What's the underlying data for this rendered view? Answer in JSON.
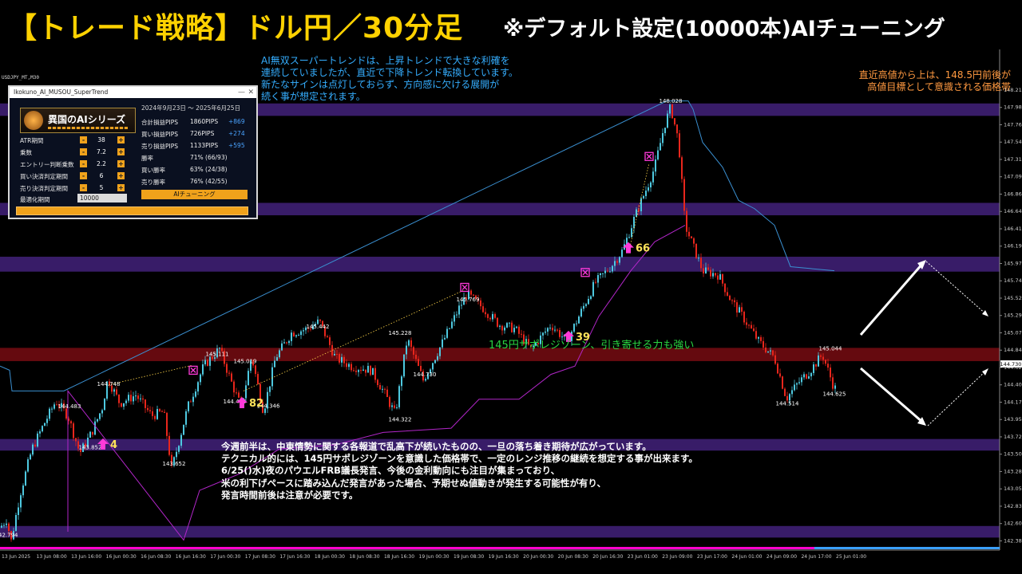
{
  "title": {
    "main": "【トレード戦略】ドル円／30分足",
    "sub": "※デフォルト設定(10000本)AIチューニング"
  },
  "symbol_label": "USDJPY_MT,M30",
  "notes": {
    "ai_trend": [
      "AI無双スーパートレンドは、上昇トレンドで大きな利確を",
      "連続していましたが、直近で下降トレンド転換しています。",
      "新たなサインは点灯しておらず、方向感に欠ける展開が",
      "続く事が想定されます。"
    ],
    "target": [
      "直近高値から上は、148.5円前後が",
      "高値目標として意識される価格帯"
    ],
    "zone": "145円サポレジゾーン、引き寄せる力も強い",
    "outlook": [
      "今週前半は、中東情勢に関する各報道で乱高下が続いたものの、一旦の落ち着き期待が広がっています。",
      "テクニカル的には、145円サポレジゾーンを意識した価格帯で、一定のレンジ推移の継続を想定する事が出来ます。",
      "6/25()水)夜のパウエルFRB議長発言、今後の金利動向にも注目が集まっており、",
      "米の利下げペースに踏み込んだ発言があった場合、予期せぬ値動きが発生する可能性が有り、",
      "発言時間前後は注意が必要です。"
    ]
  },
  "panel": {
    "window_title": "Ikokuno_AI_MUSOU_SuperTrend",
    "banner": "異国のAIシリーズ",
    "period": "2024年9月23日 ～ 2025年6月25日",
    "params": [
      {
        "label": "ATR期間",
        "value": "38"
      },
      {
        "label": "乗数",
        "value": "7.2"
      },
      {
        "label": "エントリー判断乗数",
        "value": "2.2"
      },
      {
        "label": "買い決済判定期間",
        "value": "6"
      },
      {
        "label": "売り決済判定期間",
        "value": "5"
      }
    ],
    "minus": "-",
    "plus": "+",
    "stats": [
      {
        "label": "合計損益PIPS",
        "value": "1860PIPS",
        "diff": "+869"
      },
      {
        "label": "買い損益PIPS",
        "value": "726PIPS",
        "diff": "+274"
      },
      {
        "label": "売り損益PIPS",
        "value": "1133PIPS",
        "diff": "+595"
      },
      {
        "label": "勝率",
        "value": "71% (66/93)",
        "diff": ""
      },
      {
        "label": "買い勝率",
        "value": "63% (24/38)",
        "diff": ""
      },
      {
        "label": "売り勝率",
        "value": "76% (42/55)",
        "diff": ""
      }
    ],
    "tune_button": "AIチューニング",
    "opt_label": "最適化期間",
    "opt_value": "10000"
  },
  "chart_data": {
    "type": "candlestick",
    "symbol": "USDJPY",
    "timeframe": "M30",
    "ylim": [
      142.66,
      148.26
    ],
    "price_ticks": [
      "148.210",
      "147.985",
      "147.760",
      "147.540",
      "147.315",
      "147.090",
      "146.865",
      "146.640",
      "146.415",
      "146.190",
      "145.970",
      "145.745",
      "145.520",
      "145.295",
      "145.070",
      "144.845",
      "144.625",
      "144.400",
      "144.175",
      "143.950",
      "143.725",
      "143.500",
      "143.280",
      "143.055",
      "142.830",
      "142.605",
      "142.380"
    ],
    "time_ticks": [
      "13 Jun 2025",
      "13 Jun 08:00",
      "13 Jun 16:00",
      "16 Jun 00:30",
      "16 Jun 08:30",
      "16 Jun 16:30",
      "17 Jun 00:30",
      "17 Jun 08:30",
      "17 Jun 16:30",
      "18 Jun 00:30",
      "18 Jun 08:30",
      "18 Jun 16:30",
      "19 Jun 00:30",
      "19 Jun 08:30",
      "19 Jun 16:30",
      "20 Jun 00:30",
      "20 Jun 08:30",
      "20 Jun 16:30",
      "23 Jun 01:00",
      "23 Jun 09:00",
      "23 Jun 17:00",
      "24 Jun 01:00",
      "24 Jun 09:00",
      "24 Jun 17:00",
      "25 Jun 01:00"
    ],
    "current_price": "144.730",
    "price_path": [
      [
        0,
        142.95
      ],
      [
        8,
        143.05
      ],
      [
        14,
        142.79
      ],
      [
        25,
        143.35
      ],
      [
        40,
        143.9
      ],
      [
        55,
        144.2
      ],
      [
        70,
        144.48
      ],
      [
        85,
        144.3
      ],
      [
        100,
        143.85
      ],
      [
        115,
        144.1
      ],
      [
        128,
        144.4
      ],
      [
        135,
        144.75
      ],
      [
        150,
        144.45
      ],
      [
        170,
        144.55
      ],
      [
        190,
        144.3
      ],
      [
        205,
        144.35
      ],
      [
        215,
        143.65
      ],
      [
        235,
        144.4
      ],
      [
        255,
        144.9
      ],
      [
        275,
        145.11
      ],
      [
        290,
        144.7
      ],
      [
        302,
        144.4
      ],
      [
        315,
        145.02
      ],
      [
        330,
        144.35
      ],
      [
        345,
        145.0
      ],
      [
        365,
        145.3
      ],
      [
        385,
        145.35
      ],
      [
        400,
        145.44
      ],
      [
        420,
        145.0
      ],
      [
        440,
        144.9
      ],
      [
        465,
        144.85
      ],
      [
        480,
        144.6
      ],
      [
        495,
        144.32
      ],
      [
        510,
        145.23
      ],
      [
        530,
        144.73
      ],
      [
        555,
        145.2
      ],
      [
        575,
        145.6
      ],
      [
        585,
        145.77
      ],
      [
        605,
        145.6
      ],
      [
        625,
        145.4
      ],
      [
        645,
        145.35
      ],
      [
        665,
        145.1
      ],
      [
        690,
        145.4
      ],
      [
        710,
        145.2
      ],
      [
        725,
        145.5
      ],
      [
        745,
        145.9
      ],
      [
        765,
        146.1
      ],
      [
        780,
        146.3
      ],
      [
        795,
        146.7
      ],
      [
        810,
        147.05
      ],
      [
        820,
        147.3
      ],
      [
        832,
        147.8
      ],
      [
        840,
        148.03
      ],
      [
        850,
        147.6
      ],
      [
        858,
        146.6
      ],
      [
        870,
        146.3
      ],
      [
        880,
        146.05
      ],
      [
        900,
        146.0
      ],
      [
        915,
        145.7
      ],
      [
        930,
        145.5
      ],
      [
        950,
        145.2
      ],
      [
        970,
        145.0
      ],
      [
        985,
        144.51
      ],
      [
        1000,
        144.7
      ],
      [
        1015,
        144.85
      ],
      [
        1030,
        145.04
      ],
      [
        1045,
        144.63
      ]
    ],
    "supertrend_upper": [
      [
        0,
        144.9
      ],
      [
        12,
        144.85
      ],
      [
        15,
        144.6
      ],
      [
        60,
        144.6
      ],
      [
        80,
        144.6
      ],
      [
        835,
        148.1
      ],
      [
        862,
        148.1
      ],
      [
        868,
        148.0
      ],
      [
        880,
        147.6
      ],
      [
        905,
        147.3
      ],
      [
        925,
        146.9
      ],
      [
        945,
        146.8
      ],
      [
        970,
        146.6
      ],
      [
        990,
        146.1
      ],
      [
        1045,
        146.05
      ]
    ],
    "supertrend_lower": [
      [
        85,
        142.9
      ],
      [
        85,
        144.6
      ],
      [
        230,
        142.8
      ],
      [
        250,
        143.4
      ],
      [
        300,
        143.6
      ],
      [
        350,
        143.9
      ],
      [
        420,
        143.95
      ],
      [
        480,
        144.1
      ],
      [
        565,
        144.15
      ],
      [
        600,
        144.5
      ],
      [
        650,
        144.5
      ],
      [
        690,
        144.8
      ],
      [
        720,
        144.9
      ],
      [
        750,
        145.5
      ],
      [
        790,
        146.05
      ],
      [
        820,
        146.4
      ],
      [
        858,
        146.6
      ]
    ],
    "high_low_labels": [
      {
        "x": 8,
        "y": 142.79,
        "text": "142.794"
      },
      {
        "x": 87,
        "y": 144.48,
        "text": "144.483"
      },
      {
        "x": 113,
        "y": 143.85,
        "text": "143.852"
      },
      {
        "x": 136,
        "y": 144.75,
        "text": "144.748"
      },
      {
        "x": 218,
        "y": 143.65,
        "text": "143.652"
      },
      {
        "x": 272,
        "y": 145.11,
        "text": "145.111"
      },
      {
        "x": 294,
        "y": 144.4,
        "text": "144.405"
      },
      {
        "x": 307,
        "y": 145.02,
        "text": "145.019"
      },
      {
        "x": 336,
        "y": 144.35,
        "text": "144.346"
      },
      {
        "x": 398,
        "y": 145.44,
        "text": "145.442"
      },
      {
        "x": 501,
        "y": 145.23,
        "text": "145.228"
      },
      {
        "x": 501,
        "y": 144.32,
        "text": "144.322"
      },
      {
        "x": 532,
        "y": 144.73,
        "text": "144.730"
      },
      {
        "x": 586,
        "y": 145.77,
        "text": "145.769"
      },
      {
        "x": 840,
        "y": 148.03,
        "text": "148.028"
      },
      {
        "x": 986,
        "y": 144.51,
        "text": "144.514"
      },
      {
        "x": 1040,
        "y": 145.04,
        "text": "145.044"
      },
      {
        "x": 1045,
        "y": 144.63,
        "text": "144.625"
      }
    ],
    "buy_signals": [
      {
        "x": 129,
        "y": 143.95,
        "text": "4"
      },
      {
        "x": 303,
        "y": 144.45,
        "text": "82"
      },
      {
        "x": 712,
        "y": 145.25,
        "text": "39"
      },
      {
        "x": 787,
        "y": 146.32,
        "text": "66"
      }
    ],
    "exit_marks": [
      {
        "x": 242,
        "y": 144.85
      },
      {
        "x": 582,
        "y": 145.85
      },
      {
        "x": 733,
        "y": 146.03
      },
      {
        "x": 813,
        "y": 147.43
      }
    ],
    "zones": [
      {
        "y0": 147.92,
        "y1": 148.07,
        "color": "#3b1d6e"
      },
      {
        "y0": 146.72,
        "y1": 146.87,
        "color": "#3b1d6e"
      },
      {
        "y0": 146.04,
        "y1": 146.22,
        "color": "#3b1d6e"
      },
      {
        "y0": 144.96,
        "y1": 145.12,
        "color": "#6a0b10"
      },
      {
        "y0": 143.88,
        "y1": 144.02,
        "color": "#3b1d6e"
      },
      {
        "y0": 142.83,
        "y1": 142.97,
        "color": "#3b1d6e"
      }
    ]
  },
  "colors": {
    "title": "#ffd200",
    "bull": "#4ec9e0",
    "bear": "#e8261c",
    "supertrend_down": "#3a8fd0",
    "supertrend_up": "#b226c9",
    "signal": "#ff3ad9",
    "zone_label": "#29d641"
  }
}
